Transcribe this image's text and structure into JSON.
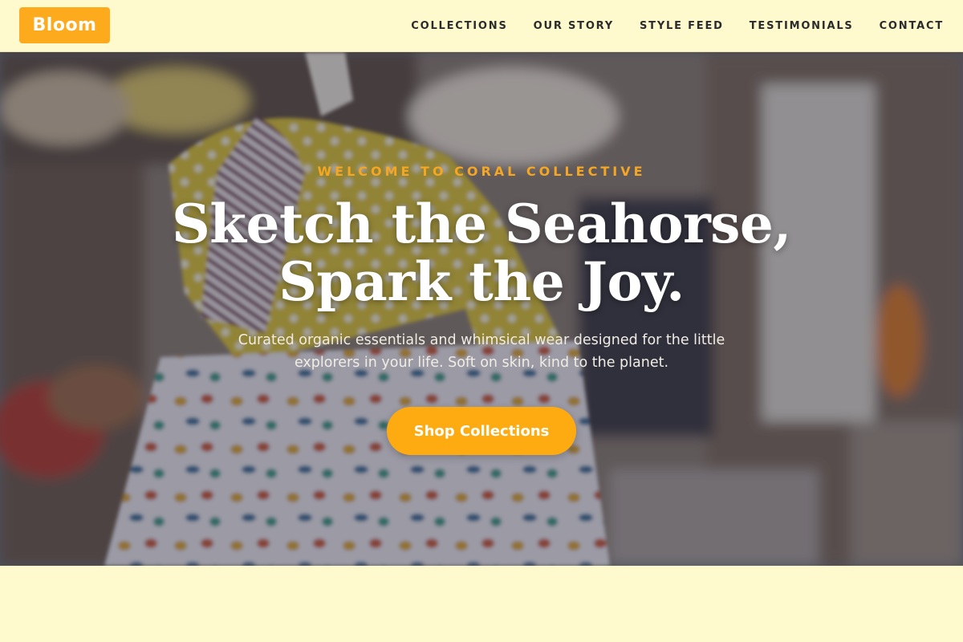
{
  "brand": {
    "logo_text": "Bloom"
  },
  "nav": {
    "items": [
      {
        "label": "COLLECTIONS"
      },
      {
        "label": "OUR STORY"
      },
      {
        "label": "STYLE FEED"
      },
      {
        "label": "TESTIMONIALS"
      },
      {
        "label": "CONTACT"
      }
    ]
  },
  "hero": {
    "eyebrow": "WELCOME TO CORAL COLLECTIVE",
    "headline_line1": "Sketch the Seahorse,",
    "headline_line2": "Spark the Joy.",
    "subtext_line1": "Curated organic essentials and whimsical wear designed for the little",
    "subtext_line2": "explorers in your life. Soft on skin, kind to the planet.",
    "cta_label": "Shop Collections",
    "background_image": "blurred-kids-clothing-rack-photo"
  },
  "colors": {
    "page_background": "#fefacd",
    "accent": "#fdab1d",
    "eyebrow": "#f5a623",
    "nav_text": "#2b2b2b"
  }
}
